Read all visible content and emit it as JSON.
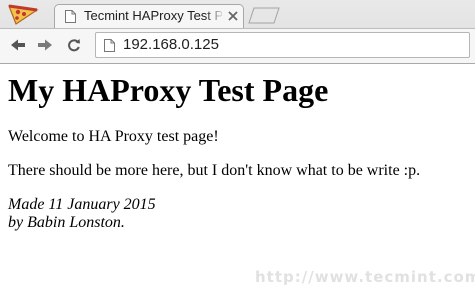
{
  "browser": {
    "tab": {
      "title": "Tecmint HAProxy Test Page",
      "icons": [
        "page-icon",
        "close-icon"
      ]
    },
    "toolbar": {
      "icons": [
        "back-arrow-icon",
        "forward-arrow-icon",
        "reload-icon",
        "page-icon"
      ],
      "url": "192.168.0.125"
    }
  },
  "page": {
    "heading": "My HAProxy Test Page",
    "paragraphs": [
      "Welcome to HA Proxy test page!",
      "There should be more here, but I don't know what to be write :p."
    ],
    "address": {
      "line1": "Made 11 January 2015",
      "line2": "by Babin Lonston."
    }
  },
  "watermark": "http://www.tecmint.com"
}
